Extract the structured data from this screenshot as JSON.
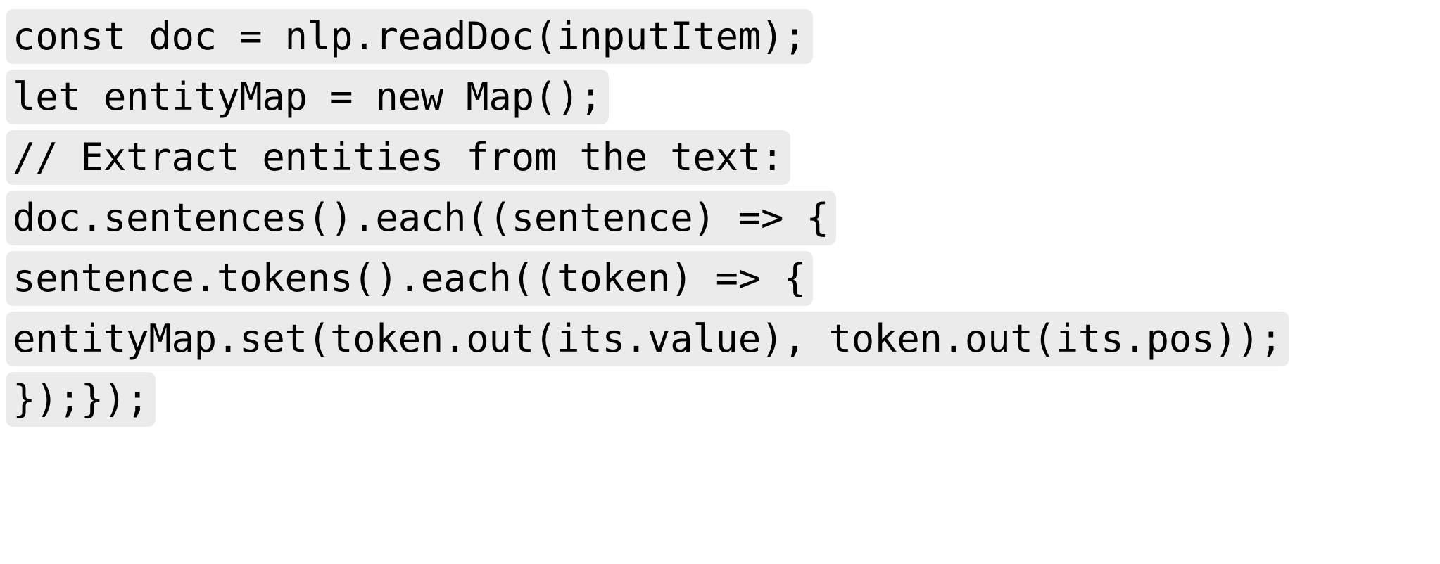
{
  "document": {
    "kind": "code-snippet",
    "language": "javascript",
    "background_color": "#ffffff",
    "highlight_color": "#ebebeb",
    "text_color": "#000000",
    "lines": [
      {
        "id": "line-1",
        "text": "const doc = nlp.readDoc(inputItem);"
      },
      {
        "id": "line-2",
        "text": "let entityMap = new Map();"
      },
      {
        "id": "line-3",
        "text": "// Extract entities from the text:"
      },
      {
        "id": "line-4",
        "text": "doc.sentences().each((sentence) => {"
      },
      {
        "id": "line-5",
        "text": "sentence.tokens().each((token) => {"
      },
      {
        "id": "line-6",
        "text": "entityMap.set(token.out(its.value), token.out(its.pos));"
      },
      {
        "id": "line-7",
        "text": "});});"
      }
    ]
  }
}
